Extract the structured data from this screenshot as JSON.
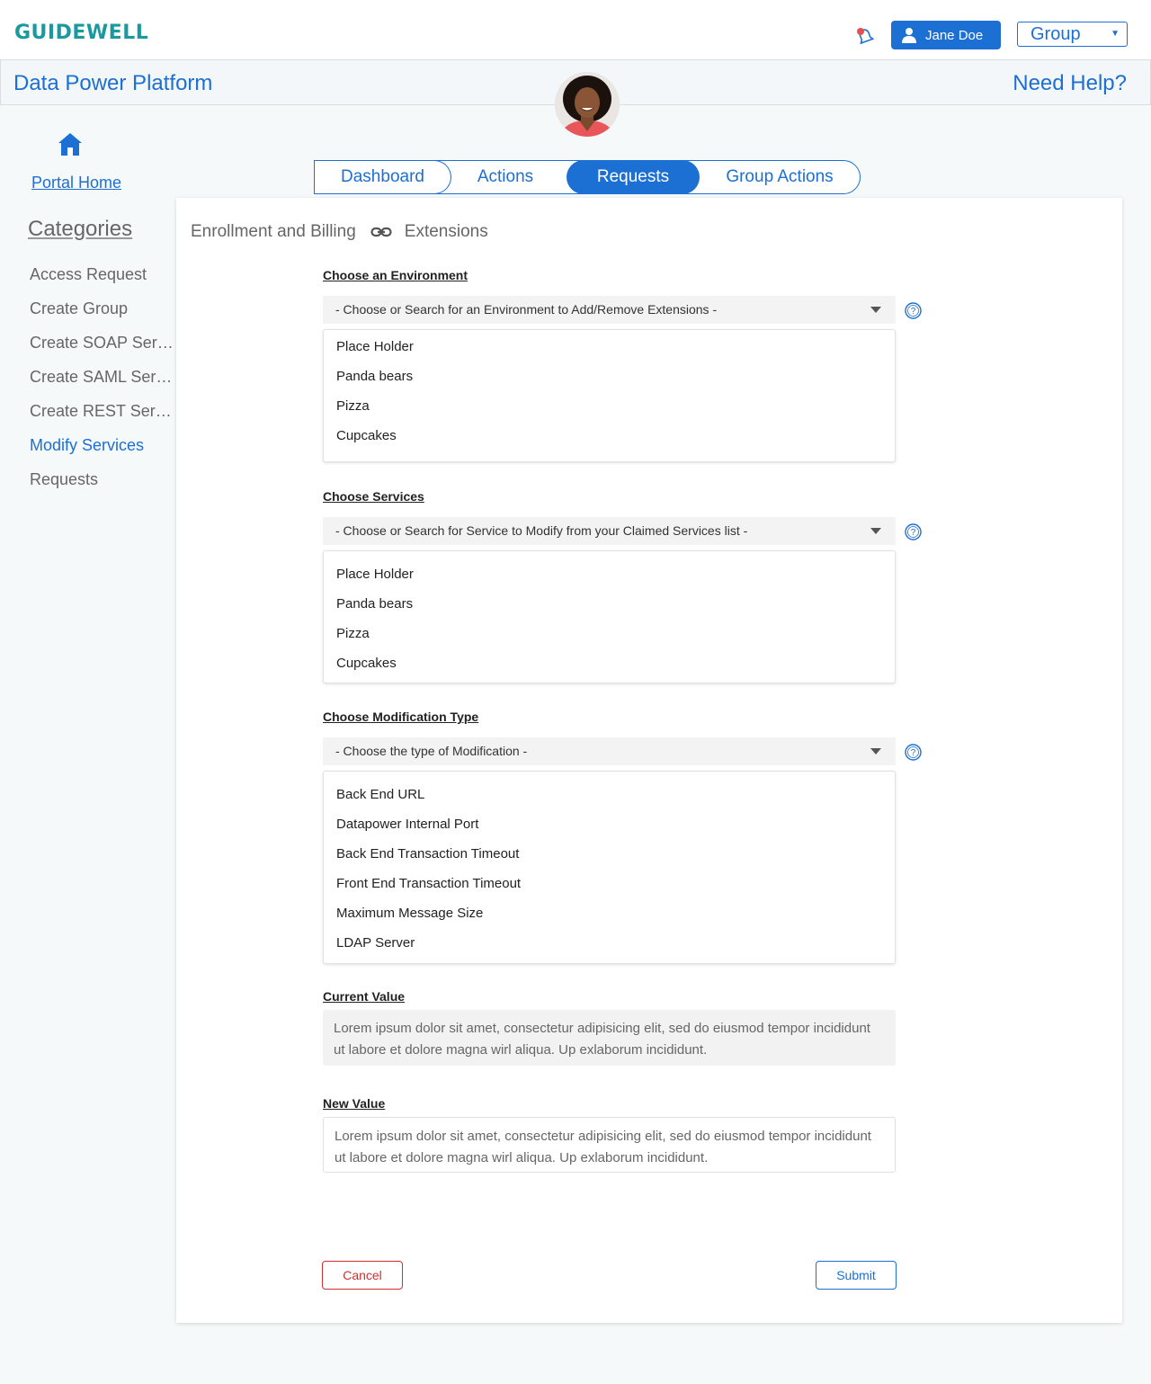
{
  "header": {
    "logo": "GUIDEWELL",
    "user_name": "Jane Doe",
    "group_select": "Group"
  },
  "titlebar": {
    "app_title": "Data Power Platform",
    "help": "Need Help?"
  },
  "sidebar": {
    "home_label": "Portal Home",
    "categories_title": "Categories",
    "items": [
      {
        "label": "Access Request"
      },
      {
        "label": "Create Group"
      },
      {
        "label": "Create SOAP Servi..."
      },
      {
        "label": "Create SAML Servi..."
      },
      {
        "label": "Create REST Servi..."
      },
      {
        "label": "Modify Services"
      },
      {
        "label": "Requests"
      }
    ],
    "active_index": 5
  },
  "tabs": [
    {
      "label": "Dashboard"
    },
    {
      "label": "Actions"
    },
    {
      "label": "Requests"
    },
    {
      "label": "Group Actions"
    }
  ],
  "active_tab": "Requests",
  "breadcrumb": {
    "first": "Enrollment and Billing",
    "second": "Extensions"
  },
  "form": {
    "environment": {
      "label": "Choose an Environment",
      "placeholder": "- Choose or Search for an Environment to Add/Remove Extensions -",
      "options": [
        "Place Holder",
        "Panda bears",
        "Pizza",
        "Cupcakes"
      ]
    },
    "services": {
      "label": "Choose Services",
      "placeholder": "- Choose or Search for Service to Modify from your Claimed Services list -",
      "options": [
        "Place Holder",
        "Panda bears",
        "Pizza",
        "Cupcakes"
      ]
    },
    "modification": {
      "label": "Choose Modification Type",
      "placeholder": "- Choose the type of Modification -",
      "options": [
        "Back End URL",
        "Datapower Internal Port",
        "Back End Transaction Timeout",
        "Front End Transaction Timeout",
        "Maximum Message Size",
        "LDAP Server"
      ]
    },
    "current_value": {
      "label": "Current Value",
      "text": "Lorem ipsum dolor sit amet, consectetur adipisicing elit, sed do eiusmod tempor incididunt ut labore et dolore magna wirl aliqua. Up exlaborum incididunt."
    },
    "new_value": {
      "label": "New Value",
      "text": "Lorem ipsum dolor sit amet, consectetur adipisicing elit, sed do eiusmod tempor incididunt ut labore et dolore magna wirl aliqua. Up exlaborum incididunt."
    },
    "cancel_label": "Cancel",
    "submit_label": "Submit"
  },
  "colors": {
    "brand_teal": "#1a9a9f",
    "primary_blue": "#1c6fd3",
    "cancel_red": "#d32f2f",
    "notification_dot": "#e8504a"
  },
  "icons": {
    "bell": "bell-icon",
    "user": "user-icon",
    "home": "home-icon",
    "link": "link-icon",
    "help": "question-circle-icon",
    "dropdown": "caret-down-icon"
  }
}
